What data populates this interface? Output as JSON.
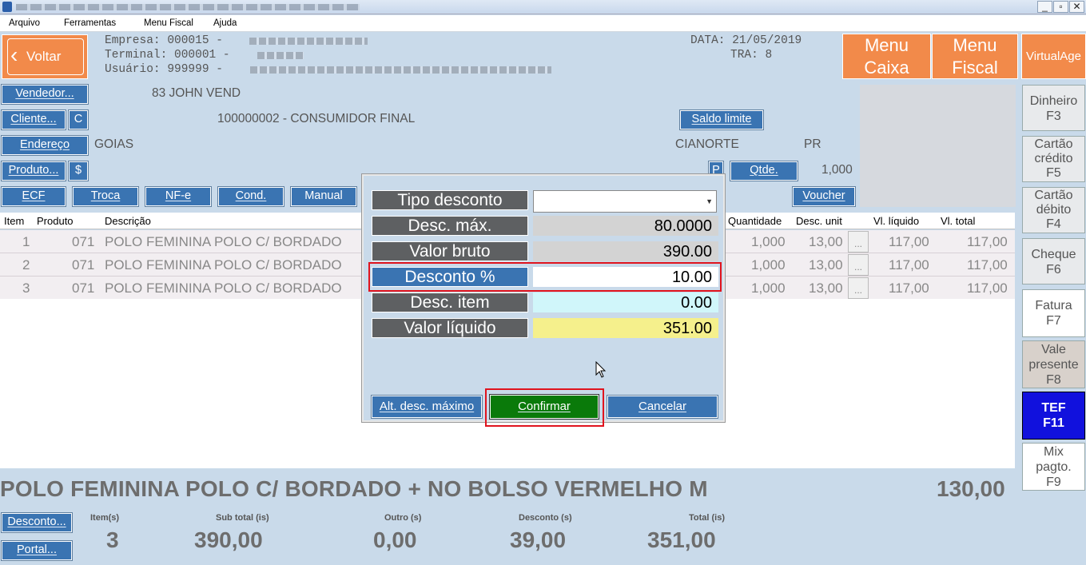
{
  "window": {
    "min_glyph": "_",
    "restore_glyph": "▫",
    "close_glyph": "✕"
  },
  "menu": [
    "Arquivo",
    "Ferramentas",
    "Menu Fiscal",
    "Ajuda"
  ],
  "header": {
    "voltar": "Voltar",
    "empresa_label": "Empresa: 000015 -",
    "terminal_label": "Terminal: 000001 -",
    "usuario_label": "Usuário: 999999 -",
    "data_label": "DATA: 21/05/2019",
    "tra_label": "TRA: 8",
    "menu_caixa": [
      "Menu",
      "Caixa"
    ],
    "menu_fiscal": [
      "Menu",
      "Fiscal"
    ],
    "virtualage": "VirtualAge"
  },
  "customer": {
    "vendedor_btn": "Vendedor...",
    "vendedor_name": "83 JOHN VEND",
    "cliente_btn": "Cliente...",
    "c_btn": "C",
    "cliente_name": "100000002 - CONSUMIDOR FINAL",
    "saldo_btn": "Saldo limite",
    "endereco_btn": "Endereço",
    "state": "GOIAS",
    "city": "CIANORTE",
    "uf": "PR",
    "produto_btn": "Produto...",
    "dollar_btn": "$",
    "p_btn": "P",
    "qtde_btn": "Qtde.",
    "qtde_value": "1,000",
    "voucher_btn": "Voucher"
  },
  "actions": [
    "ECF",
    "Troca",
    "NF-e",
    "Cond.",
    "Manual"
  ],
  "grid": {
    "headers": [
      "Item",
      "Produto",
      "Descrição",
      "Quantidade",
      "Desc. unit",
      "Vl. líquido",
      "Vl. total"
    ],
    "rows": [
      {
        "item": "1",
        "produto": "071",
        "descricao": "POLO FEMININA POLO C/ BORDADO",
        "qtd": "1,000",
        "desc": "13,00",
        "liquido": "117,00",
        "total": "117,00"
      },
      {
        "item": "2",
        "produto": "071",
        "descricao": "POLO FEMININA POLO C/ BORDADO",
        "qtd": "1,000",
        "desc": "13,00",
        "liquido": "117,00",
        "total": "117,00"
      },
      {
        "item": "3",
        "produto": "071",
        "descricao": "POLO FEMININA POLO C/ BORDADO",
        "qtd": "1,000",
        "desc": "13,00",
        "liquido": "117,00",
        "total": "117,00"
      }
    ],
    "dots": "..."
  },
  "side_buttons": [
    {
      "line1": "Dinheiro",
      "line2": "F3"
    },
    {
      "line1": "Cartão crédito",
      "line2": "F5"
    },
    {
      "line1": "Cartão débito",
      "line2": "F4"
    },
    {
      "line1": "Cheque",
      "line2": "F6"
    },
    {
      "line1": "Fatura",
      "line2": "F7"
    },
    {
      "line1": "Vale presente",
      "line2": "F8"
    },
    {
      "line1": "TEF",
      "line2": "F11"
    },
    {
      "line1": "Mix pagto.",
      "line2": "F9"
    }
  ],
  "dialog": {
    "tipo_desconto": "Tipo desconto",
    "desc_max_label": "Desc. máx.",
    "desc_max_value": "80.0000",
    "valor_bruto_label": "Valor bruto",
    "valor_bruto_value": "390.00",
    "desconto_pct_label": "Desconto %",
    "desconto_pct_value": "10.00",
    "desc_item_label": "Desc. item",
    "desc_item_value": "0.00",
    "valor_liquido_label": "Valor líquido",
    "valor_liquido_value": "351.00",
    "alt_desc_btn": "Alt. desc. máximo",
    "confirmar_btn": "Confirmar",
    "cancelar_btn": "Cancelar",
    "highlight_color": "#e0141e",
    "confirm_color": "#0a7a0a"
  },
  "footer": {
    "product_name": "POLO FEMININA POLO C/ BORDADO + NO BOLSO VERMELHO M",
    "product_price": "130,00",
    "desconto_btn": "Desconto...",
    "portal_btn": "Portal...",
    "items_label": "Item(s)",
    "items_value": "3",
    "subtotal_label": "Sub total (is)",
    "subtotal_value": "390,00",
    "outro_label": "Outro (s)",
    "outro_value": "0,00",
    "desconto_label": "Desconto (s)",
    "desconto_value": "39,00",
    "total_label": "Total (is)",
    "total_value": "351,00"
  }
}
